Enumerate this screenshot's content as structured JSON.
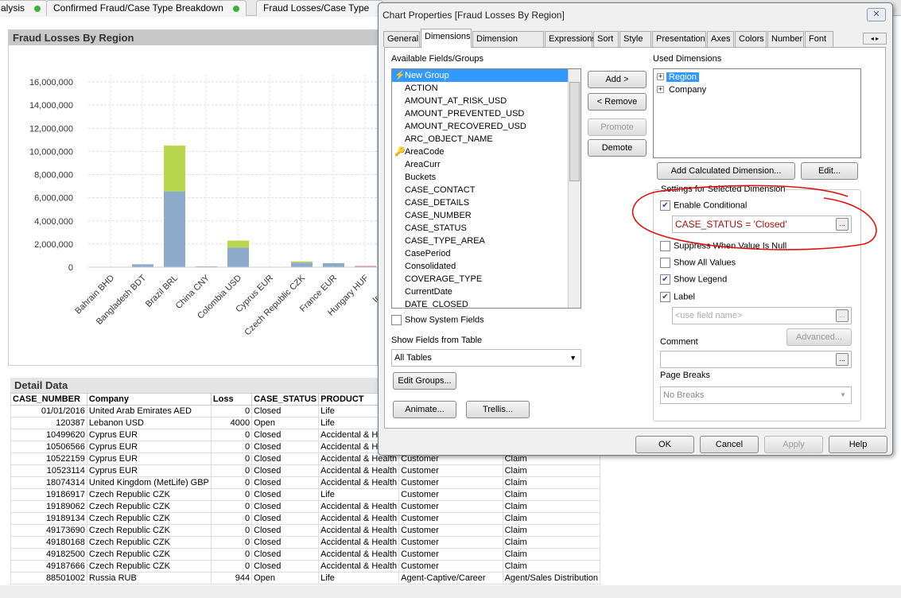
{
  "sheet_tabs": [
    {
      "label": "alysis"
    },
    {
      "label": "Confirmed Fraud/Case Type Breakdown"
    },
    {
      "label": "Fraud Losses/Case Type"
    }
  ],
  "chart_object": {
    "title": "Fraud Losses By Region"
  },
  "chart_data": {
    "type": "bar",
    "stacked": true,
    "title": "Fraud Losses By Region",
    "categories": [
      "Bahrain BHD",
      "Bangladesh BDT",
      "Brazil BRL",
      "China CNY",
      "Colombia USD",
      "Cyprus EUR",
      "Czech Republic CZK",
      "France EUR",
      "Hungary HUF",
      "Ireland EUR"
    ],
    "category_labels": [
      "Bahrain BHD",
      "Bangladesh BDT",
      "Brazil BRL",
      "China CNY",
      "Colombia USD",
      "Cyprus EUR",
      "Czech Republic CZK",
      "France EUR",
      "Hungary HUF",
      "Ireland E"
    ],
    "series": [
      {
        "color": "#8eaacb",
        "values": [
          0,
          250000,
          6550000,
          70000,
          1700000,
          0,
          400000,
          350000,
          0,
          0
        ]
      },
      {
        "color": "#bad64e",
        "values": [
          0,
          0,
          3950000,
          0,
          600000,
          0,
          100000,
          0,
          0,
          0
        ]
      },
      {
        "color": "#cc7a80",
        "values": [
          0,
          0,
          0,
          0,
          0,
          0,
          0,
          0,
          100000,
          0
        ]
      }
    ],
    "yticks": [
      "0",
      "2,000,000",
      "4,000,000",
      "6,000,000",
      "8,000,000",
      "10,000,000",
      "12,000,000",
      "14,000,000",
      "16,000,000"
    ],
    "ylim": [
      0,
      16000000
    ],
    "grid": true,
    "xlabel": "",
    "ylabel": ""
  },
  "detail": {
    "title": "Detail Data",
    "columns": [
      "CASE_NUMBER",
      "Company",
      "Loss",
      "CASE_STATUS",
      "PRODUCT",
      "",
      ""
    ],
    "rows": [
      [
        "01/01/2016",
        "United Arab Emirates AED",
        "0",
        "Closed",
        "Life",
        "",
        ""
      ],
      [
        "120387",
        "Lebanon USD",
        "4000",
        "Open",
        "Life",
        "",
        ""
      ],
      [
        "10499620",
        "Cyprus EUR",
        "0",
        "Closed",
        "Accidental & Health",
        "",
        ""
      ],
      [
        "10506566",
        "Cyprus EUR",
        "0",
        "Closed",
        "Accidental & Health",
        "",
        ""
      ],
      [
        "10522159",
        "Cyprus EUR",
        "0",
        "Closed",
        "Accidental & Health",
        "Customer",
        "Claim"
      ],
      [
        "10523114",
        "Cyprus EUR",
        "0",
        "Closed",
        "Accidental & Health",
        "Customer",
        "Claim"
      ],
      [
        "18074314",
        "United Kingdom (MetLife) GBP",
        "0",
        "Closed",
        "Accidental & Health",
        "Customer",
        "Claim"
      ],
      [
        "19186917",
        "Czech Republic CZK",
        "0",
        "Closed",
        "Life",
        "Customer",
        "Claim"
      ],
      [
        "19189062",
        "Czech Republic CZK",
        "0",
        "Closed",
        "Accidental & Health",
        "Customer",
        "Claim"
      ],
      [
        "19189134",
        "Czech Republic CZK",
        "0",
        "Closed",
        "Accidental & Health",
        "Customer",
        "Claim"
      ],
      [
        "49173690",
        "Czech Republic CZK",
        "0",
        "Closed",
        "Accidental & Health",
        "Customer",
        "Claim"
      ],
      [
        "49180168",
        "Czech Republic CZK",
        "0",
        "Closed",
        "Accidental & Health",
        "Customer",
        "Claim"
      ],
      [
        "49182500",
        "Czech Republic CZK",
        "0",
        "Closed",
        "Accidental & Health",
        "Customer",
        "Claim"
      ],
      [
        "49187666",
        "Czech Republic CZK",
        "0",
        "Closed",
        "Accidental & Health",
        "Customer",
        "Claim"
      ],
      [
        "88501002",
        "Russia RUB",
        "944",
        "Open",
        "Life",
        "Agent-Captive/Career",
        "Agent/Sales Distribution"
      ]
    ]
  },
  "dialog": {
    "title": "Chart Properties [Fraud Losses By Region]",
    "close": "✕",
    "tabs": [
      "General",
      "Dimensions",
      "Dimension Limits",
      "Expressions",
      "Sort",
      "Style",
      "Presentation",
      "Axes",
      "Colors",
      "Number",
      "Font"
    ],
    "available_label": "Available Fields/Groups",
    "fields": [
      "New Group",
      "ACTION",
      "AMOUNT_AT_RISK_USD",
      "AMOUNT_PREVENTED_USD",
      "AMOUNT_RECOVERED_USD",
      "ARC_OBJECT_NAME",
      "AreaCode",
      "AreaCurr",
      "Buckets",
      "CASE_CONTACT",
      "CASE_DETAILS",
      "CASE_NUMBER",
      "CASE_STATUS",
      "CASE_TYPE_AREA",
      "CasePeriod",
      "Consolidated",
      "COVERAGE_TYPE",
      "CurrentDate",
      "DATE_CLOSED"
    ],
    "add": "Add >",
    "remove": "< Remove",
    "promote": "Promote",
    "demote": "Demote",
    "show_system_fields": "Show System Fields",
    "show_fields_from": "Show Fields from Table",
    "table_select": "All Tables",
    "edit_groups": "Edit Groups...",
    "animate": "Animate...",
    "trellis": "Trellis...",
    "used_label": "Used Dimensions",
    "used": [
      "Region",
      "Company"
    ],
    "add_calc": "Add Calculated Dimension...",
    "edit": "Edit...",
    "settings_label": "Settings for Selected Dimension",
    "enable_conditional": {
      "label": "Enable Conditional",
      "checked": true
    },
    "condition": "CASE_STATUS = 'Closed'",
    "suppress_null": {
      "label": "Suppress When Value Is Null",
      "checked": false
    },
    "show_all": {
      "label": "Show All Values",
      "checked": false
    },
    "show_legend": {
      "label": "Show Legend",
      "checked": true
    },
    "label_chk": {
      "label": "Label",
      "checked": true
    },
    "label_placeholder": "<use field name>",
    "advanced": "Advanced...",
    "comment_label": "Comment",
    "page_breaks_label": "Page Breaks",
    "page_breaks": "No Breaks",
    "ok": "OK",
    "cancel": "Cancel",
    "apply": "Apply",
    "help": "Help",
    "annotation_color": "#e01010"
  }
}
